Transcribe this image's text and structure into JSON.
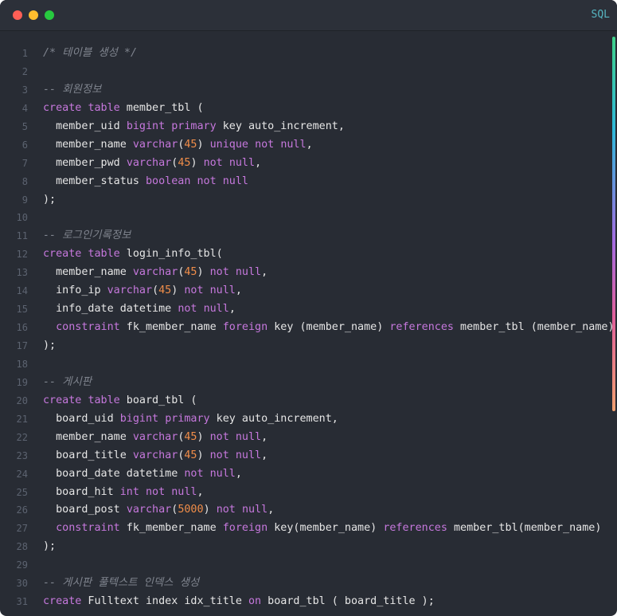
{
  "window": {
    "language_badge": "SQL"
  },
  "colors": {
    "background": "#282c34",
    "comment": "#7f848e",
    "keyword": "#c678dd",
    "number": "#f08d49",
    "text": "#e6e6e6"
  },
  "lines": [
    {
      "n": "1",
      "tokens": [
        [
          "c",
          "/* 테이블 생성 */"
        ]
      ]
    },
    {
      "n": "2",
      "tokens": []
    },
    {
      "n": "3",
      "tokens": [
        [
          "c",
          "-- 회원정보"
        ]
      ]
    },
    {
      "n": "4",
      "tokens": [
        [
          "k",
          "create"
        ],
        [
          "t",
          " "
        ],
        [
          "k",
          "table"
        ],
        [
          "t",
          " member_tbl ("
        ]
      ]
    },
    {
      "n": "5",
      "tokens": [
        [
          "t",
          "  member_uid "
        ],
        [
          "k",
          "bigint"
        ],
        [
          "t",
          " "
        ],
        [
          "k",
          "primary"
        ],
        [
          "t",
          " key auto_increment,"
        ]
      ]
    },
    {
      "n": "6",
      "tokens": [
        [
          "t",
          "  member_name "
        ],
        [
          "k",
          "varchar"
        ],
        [
          "t",
          "("
        ],
        [
          "n",
          "45"
        ],
        [
          "t",
          ") "
        ],
        [
          "k",
          "unique"
        ],
        [
          "t",
          " "
        ],
        [
          "k",
          "not"
        ],
        [
          "t",
          " "
        ],
        [
          "k",
          "null"
        ],
        [
          "t",
          ","
        ]
      ]
    },
    {
      "n": "7",
      "tokens": [
        [
          "t",
          "  member_pwd "
        ],
        [
          "k",
          "varchar"
        ],
        [
          "t",
          "("
        ],
        [
          "n",
          "45"
        ],
        [
          "t",
          ") "
        ],
        [
          "k",
          "not"
        ],
        [
          "t",
          " "
        ],
        [
          "k",
          "null"
        ],
        [
          "t",
          ","
        ]
      ]
    },
    {
      "n": "8",
      "tokens": [
        [
          "t",
          "  member_status "
        ],
        [
          "k",
          "boolean"
        ],
        [
          "t",
          " "
        ],
        [
          "k",
          "not"
        ],
        [
          "t",
          " "
        ],
        [
          "k",
          "null"
        ]
      ]
    },
    {
      "n": "9",
      "tokens": [
        [
          "t",
          ");"
        ]
      ]
    },
    {
      "n": "10",
      "tokens": []
    },
    {
      "n": "11",
      "tokens": [
        [
          "c",
          "-- 로그인기록정보"
        ]
      ]
    },
    {
      "n": "12",
      "tokens": [
        [
          "k",
          "create"
        ],
        [
          "t",
          " "
        ],
        [
          "k",
          "table"
        ],
        [
          "t",
          " login_info_tbl("
        ]
      ]
    },
    {
      "n": "13",
      "tokens": [
        [
          "t",
          "  member_name "
        ],
        [
          "k",
          "varchar"
        ],
        [
          "t",
          "("
        ],
        [
          "n",
          "45"
        ],
        [
          "t",
          ") "
        ],
        [
          "k",
          "not"
        ],
        [
          "t",
          " "
        ],
        [
          "k",
          "null"
        ],
        [
          "t",
          ","
        ]
      ]
    },
    {
      "n": "14",
      "tokens": [
        [
          "t",
          "  info_ip "
        ],
        [
          "k",
          "varchar"
        ],
        [
          "t",
          "("
        ],
        [
          "n",
          "45"
        ],
        [
          "t",
          ") "
        ],
        [
          "k",
          "not"
        ],
        [
          "t",
          " "
        ],
        [
          "k",
          "null"
        ],
        [
          "t",
          ","
        ]
      ]
    },
    {
      "n": "15",
      "tokens": [
        [
          "t",
          "  info_date datetime "
        ],
        [
          "k",
          "not"
        ],
        [
          "t",
          " "
        ],
        [
          "k",
          "null"
        ],
        [
          "t",
          ","
        ]
      ]
    },
    {
      "n": "16",
      "tokens": [
        [
          "t",
          "  "
        ],
        [
          "k",
          "constraint"
        ],
        [
          "t",
          " fk_member_name "
        ],
        [
          "k",
          "foreign"
        ],
        [
          "t",
          " key (member_name) "
        ],
        [
          "k",
          "references"
        ],
        [
          "t",
          " member_tbl (member_name)"
        ]
      ]
    },
    {
      "n": "17",
      "tokens": [
        [
          "t",
          ");"
        ]
      ]
    },
    {
      "n": "18",
      "tokens": []
    },
    {
      "n": "19",
      "tokens": [
        [
          "c",
          "-- 게시판"
        ]
      ]
    },
    {
      "n": "20",
      "tokens": [
        [
          "k",
          "create"
        ],
        [
          "t",
          " "
        ],
        [
          "k",
          "table"
        ],
        [
          "t",
          " board_tbl ("
        ]
      ]
    },
    {
      "n": "21",
      "tokens": [
        [
          "t",
          "  board_uid "
        ],
        [
          "k",
          "bigint"
        ],
        [
          "t",
          " "
        ],
        [
          "k",
          "primary"
        ],
        [
          "t",
          " key auto_increment,"
        ]
      ]
    },
    {
      "n": "22",
      "tokens": [
        [
          "t",
          "  member_name "
        ],
        [
          "k",
          "varchar"
        ],
        [
          "t",
          "("
        ],
        [
          "n",
          "45"
        ],
        [
          "t",
          ") "
        ],
        [
          "k",
          "not"
        ],
        [
          "t",
          " "
        ],
        [
          "k",
          "null"
        ],
        [
          "t",
          ","
        ]
      ]
    },
    {
      "n": "23",
      "tokens": [
        [
          "t",
          "  board_title "
        ],
        [
          "k",
          "varchar"
        ],
        [
          "t",
          "("
        ],
        [
          "n",
          "45"
        ],
        [
          "t",
          ") "
        ],
        [
          "k",
          "not"
        ],
        [
          "t",
          " "
        ],
        [
          "k",
          "null"
        ],
        [
          "t",
          ","
        ]
      ]
    },
    {
      "n": "24",
      "tokens": [
        [
          "t",
          "  board_date datetime "
        ],
        [
          "k",
          "not"
        ],
        [
          "t",
          " "
        ],
        [
          "k",
          "null"
        ],
        [
          "t",
          ","
        ]
      ]
    },
    {
      "n": "25",
      "tokens": [
        [
          "t",
          "  board_hit "
        ],
        [
          "k",
          "int"
        ],
        [
          "t",
          " "
        ],
        [
          "k",
          "not"
        ],
        [
          "t",
          " "
        ],
        [
          "k",
          "null"
        ],
        [
          "t",
          ","
        ]
      ]
    },
    {
      "n": "26",
      "tokens": [
        [
          "t",
          "  board_post "
        ],
        [
          "k",
          "varchar"
        ],
        [
          "t",
          "("
        ],
        [
          "n",
          "5000"
        ],
        [
          "t",
          ") "
        ],
        [
          "k",
          "not"
        ],
        [
          "t",
          " "
        ],
        [
          "k",
          "null"
        ],
        [
          "t",
          ","
        ]
      ]
    },
    {
      "n": "27",
      "tokens": [
        [
          "t",
          "  "
        ],
        [
          "k",
          "constraint"
        ],
        [
          "t",
          " fk_member_name "
        ],
        [
          "k",
          "foreign"
        ],
        [
          "t",
          " key(member_name) "
        ],
        [
          "k",
          "references"
        ],
        [
          "t",
          " member_tbl(member_name)"
        ]
      ]
    },
    {
      "n": "28",
      "tokens": [
        [
          "t",
          ");"
        ]
      ]
    },
    {
      "n": "29",
      "tokens": []
    },
    {
      "n": "30",
      "tokens": [
        [
          "c",
          "-- 게시판 풀텍스트 인덱스 생성"
        ]
      ]
    },
    {
      "n": "31",
      "tokens": [
        [
          "k",
          "create"
        ],
        [
          "t",
          " Fulltext index idx_title "
        ],
        [
          "k",
          "on"
        ],
        [
          "t",
          " board_tbl ( board_title );"
        ]
      ]
    }
  ]
}
